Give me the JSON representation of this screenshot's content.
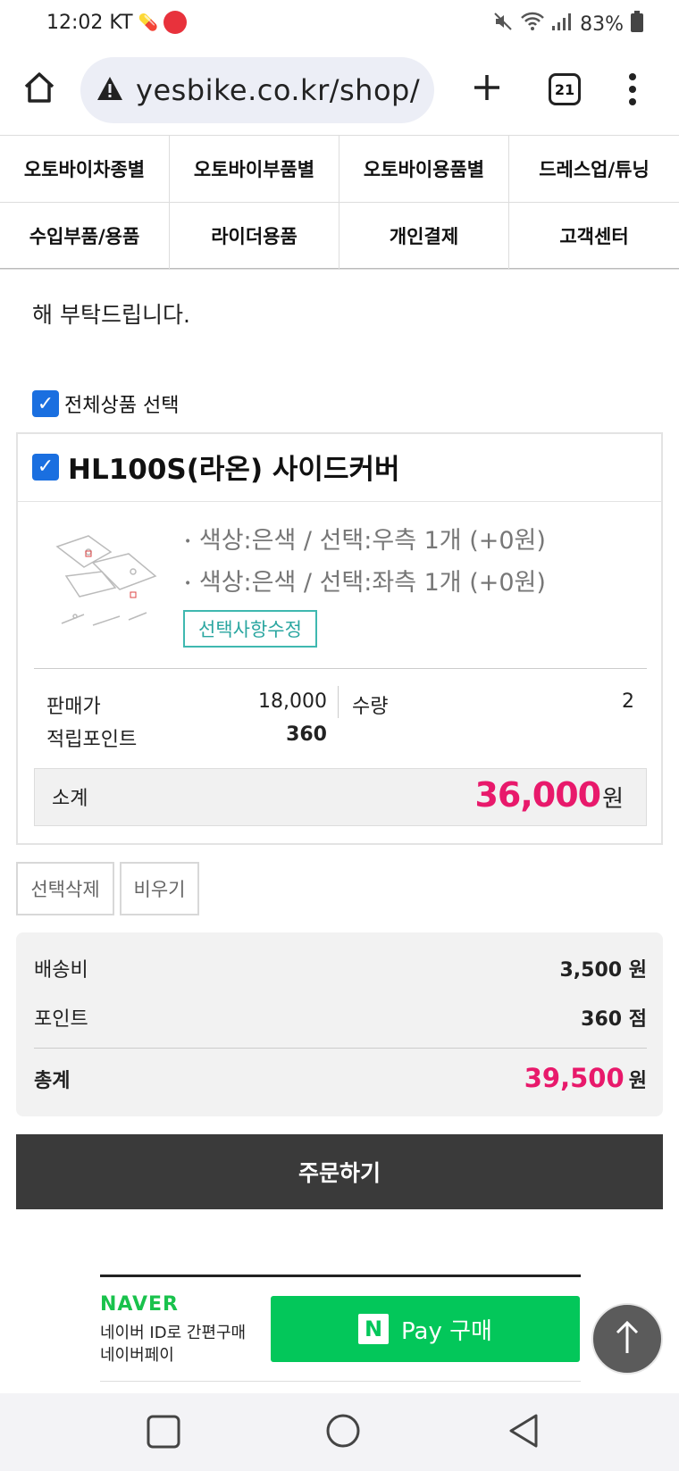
{
  "status_bar": {
    "time": "12:02 KT",
    "battery": "83%"
  },
  "browser": {
    "url": "yesbike.co.kr/shop/",
    "tab_count": "21"
  },
  "category_nav": [
    "오토바이차종별",
    "오토바이부품별",
    "오토바이용품별",
    "드레스업/튜닝",
    "수입부품/용품",
    "라이더용품",
    "개인결제",
    "고객센터"
  ],
  "notice_text": "해 부탁드립니다.",
  "select_all_label": "전체상품 선택",
  "product": {
    "title": "HL100S(라온) 사이드커버",
    "options": [
      "색상:은색 / 선택:우측 1개 (+0원)",
      "색상:은색 / 선택:좌측 1개 (+0원)"
    ],
    "edit_button": "선택사항수정",
    "price_label": "판매가",
    "price_value": "18,000",
    "qty_label": "수량",
    "qty_value": "2",
    "points_label": "적립포인트",
    "points_value": "360",
    "subtotal_label": "소계",
    "subtotal_value": "36,000",
    "subtotal_unit": "원"
  },
  "buttons": {
    "delete_selected": "선택삭제",
    "empty": "비우기",
    "order": "주문하기"
  },
  "summary": {
    "shipping_label": "배송비",
    "shipping_value": "3,500 원",
    "points_label": "포인트",
    "points_value": "360 점",
    "total_label": "총계",
    "total_value": "39,500",
    "total_unit": "원"
  },
  "naver_pay": {
    "logo": "NAVER",
    "sub1": "네이버 ID로 간편구매",
    "sub2": "네이버페이",
    "button_n": "N",
    "button_label": "Pay 구매"
  },
  "colors": {
    "accent_pink": "#e8196b",
    "checkbox_blue": "#1a6fe0",
    "naver_green": "#03c75a",
    "edit_teal": "#3fb8b0"
  }
}
